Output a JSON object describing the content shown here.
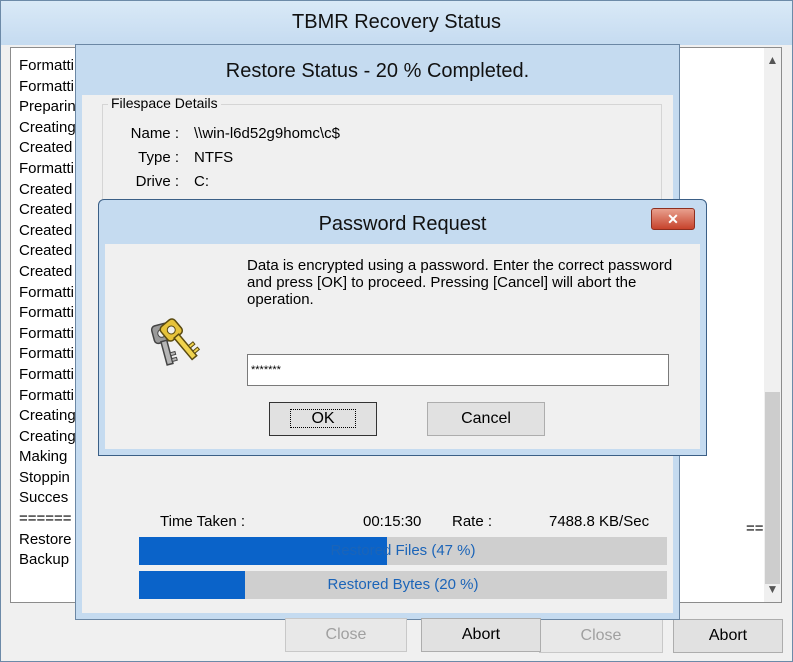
{
  "outer_window": {
    "title": "TBMR Recovery Status",
    "log_lines": [
      "Formatti",
      "Formatti",
      "Preparin",
      "Creating",
      "Created",
      "Formatti",
      "Created",
      "Created",
      "Created",
      "Created",
      "Created",
      "Formatti",
      "Formatti",
      "Formatti",
      "Formatti",
      "Formatti",
      "Formatti",
      "Creating",
      "Creating",
      "Making",
      "Stoppin",
      "Succes",
      "======",
      "Restore",
      "Backup"
    ],
    "log_right_fragment": "===",
    "close_label": "Close",
    "abort_label": "Abort"
  },
  "restore_dialog": {
    "title": "Restore Status - 20 % Completed.",
    "group_label": "Filespace Details",
    "name_label": "Name :",
    "name_value": "\\\\win-l6d52g9homc\\c$",
    "type_label": "Type :",
    "type_value": "NTFS",
    "drive_label": "Drive :",
    "drive_value": "C:",
    "time_taken_label": "Time Taken :",
    "time_taken_value": "00:15:30",
    "rate_label": "Rate :",
    "rate_value": "7488.8 KB/Sec",
    "files_progress": {
      "label": "Restored Files (47 %)",
      "percent": 47
    },
    "bytes_progress": {
      "label": "Restored Bytes (20 %)",
      "percent": 20
    },
    "close_label": "Close",
    "abort_label": "Abort"
  },
  "password_dialog": {
    "title": "Password Request",
    "close_glyph": "✕",
    "message": "Data is encrypted using a password. Enter the correct password and press [OK] to proceed. Pressing [Cancel] will abort the operation.",
    "password_value": "*******",
    "ok_label": "OK",
    "cancel_label": "Cancel",
    "icon": "keys-icon"
  }
}
